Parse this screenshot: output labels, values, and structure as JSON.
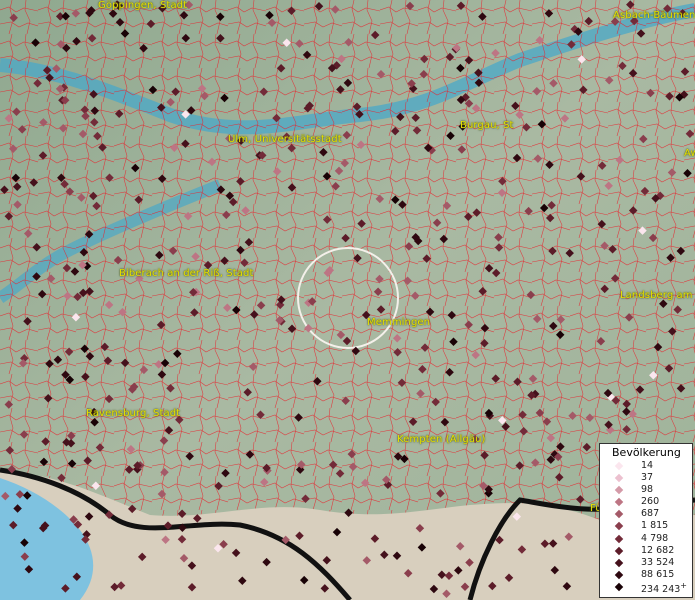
{
  "map": {
    "cities": [
      {
        "id": "goeppingen",
        "label": "Göppingen, Stadt"
      },
      {
        "id": "asbach",
        "label": "Asbach-Bäumen"
      },
      {
        "id": "ulm",
        "label": "Ulm, Universitätsstadt"
      },
      {
        "id": "burgau",
        "label": "Burgau, St"
      },
      {
        "id": "aw",
        "label": "Aw"
      },
      {
        "id": "biberach",
        "label": "Biberach an der Riß, Stadt"
      },
      {
        "id": "landsberg",
        "label": "Landsberg am L"
      },
      {
        "id": "memmingen",
        "label": "Memmingen"
      },
      {
        "id": "ravensburg",
        "label": "Ravensburg, Stadt"
      },
      {
        "id": "kempten",
        "label": "Kempten (Allgäu)"
      },
      {
        "id": "fu",
        "label": "Fü"
      }
    ],
    "colors": {
      "boundary": "#e8202a",
      "river": "#4aa8c8",
      "lake": "#7ec2e0",
      "terrain": "#9fb3a0",
      "alps": "#d8cfbe",
      "border": "#111111",
      "label": "#e6e000"
    }
  },
  "legend": {
    "title": "Bevölkerung",
    "entries": [
      {
        "label": "14",
        "color": "#fbe6ee"
      },
      {
        "label": "37",
        "color": "#ecc0cf"
      },
      {
        "label": "98",
        "color": "#d49aa8"
      },
      {
        "label": "260",
        "color": "#bd7584"
      },
      {
        "label": "687",
        "color": "#a45a68"
      },
      {
        "label": "1 815",
        "color": "#8a3e4d"
      },
      {
        "label": "4 798",
        "color": "#732b39"
      },
      {
        "label": "12 682",
        "color": "#5c1c29"
      },
      {
        "label": "33 524",
        "color": "#45111c"
      },
      {
        "label": "88 615",
        "color": "#2e0810"
      },
      {
        "label": "234 243",
        "color": "#180206",
        "plus": "+"
      }
    ]
  }
}
